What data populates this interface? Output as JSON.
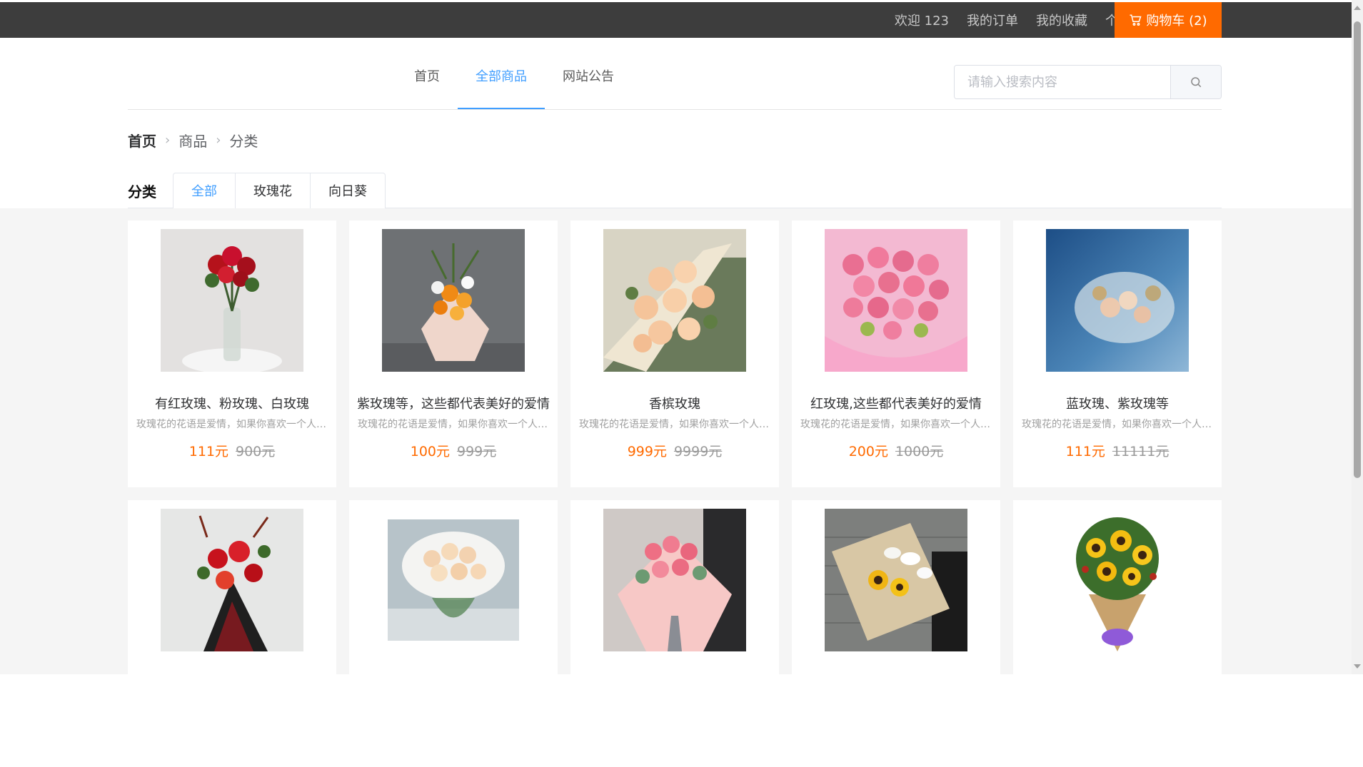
{
  "topbar": {
    "welcome": "欢迎 123",
    "orders": "我的订单",
    "favorites": "我的收藏",
    "profile": "个人中心",
    "cart": "购物车 (2)"
  },
  "nav": {
    "items": [
      {
        "label": "首页",
        "active": false
      },
      {
        "label": "全部商品",
        "active": true
      },
      {
        "label": "网站公告",
        "active": false
      }
    ],
    "search_placeholder": "请输入搜索内容"
  },
  "breadcrumb": [
    "首页",
    "商品",
    "分类"
  ],
  "category": {
    "label": "分类",
    "tabs": [
      {
        "label": "全部",
        "active": true
      },
      {
        "label": "玫瑰花",
        "active": false
      },
      {
        "label": "向日葵",
        "active": false
      }
    ]
  },
  "products": [
    {
      "name": "有红玫瑰、粉玫瑰、白玫瑰",
      "desc": "玫瑰花的花语是爱情，如果你喜欢一个人，可以送给她",
      "price": "111元",
      "old_price": "900元",
      "image": "red-roses-vase"
    },
    {
      "name": "紫玫瑰等，这些都代表美好的爱情",
      "desc": "玫瑰花的花语是爱情，如果你喜欢一个人，可以送给她",
      "price": "100元",
      "old_price": "999元",
      "image": "orange-bouquet"
    },
    {
      "name": "香槟玫瑰",
      "desc": "玫瑰花的花语是爱情，如果你喜欢一个人，可以送给她",
      "price": "999元",
      "old_price": "9999元",
      "image": "champagne-roses"
    },
    {
      "name": "红玫瑰,这些都代表美好的爱情",
      "desc": "玫瑰花的花语是爱情，如果你喜欢一个人，可以送给她",
      "price": "200元",
      "old_price": "1000元",
      "image": "pink-carnations"
    },
    {
      "name": "蓝玫瑰、紫玫瑰等",
      "desc": "玫瑰花的花语是爱情，如果你喜欢一个人，可以送给她",
      "price": "111元",
      "old_price": "11111元",
      "image": "blue-bouquet"
    },
    {
      "name": "",
      "desc": "",
      "price": "",
      "old_price": "",
      "image": "red-lily-bouquet"
    },
    {
      "name": "",
      "desc": "",
      "price": "",
      "old_price": "",
      "image": "champagne-roses-vase"
    },
    {
      "name": "",
      "desc": "",
      "price": "",
      "old_price": "",
      "image": "pink-carnation-wrap"
    },
    {
      "name": "",
      "desc": "",
      "price": "",
      "old_price": "",
      "image": "sunflower-lily"
    },
    {
      "name": "",
      "desc": "",
      "price": "",
      "old_price": "",
      "image": "sunflower-bouquet"
    }
  ]
}
